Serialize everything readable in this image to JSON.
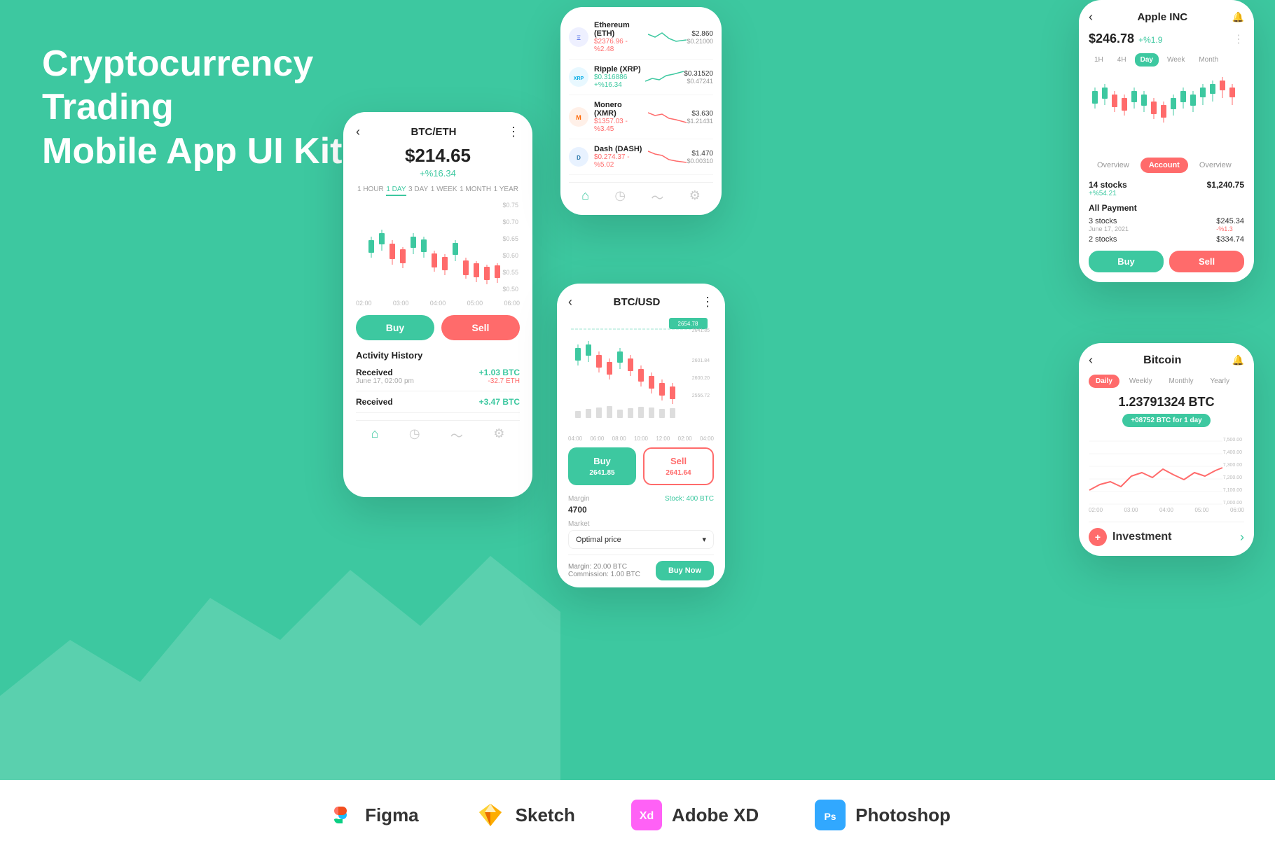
{
  "hero": {
    "title_line1": "Cryptocurrency Trading",
    "title_line2": "Mobile App UI Kit"
  },
  "tools": [
    {
      "name": "Figma",
      "color": "#F24E1E"
    },
    {
      "name": "Sketch",
      "color": "#F7B500"
    },
    {
      "name": "Adobe XD",
      "color": "#FF61F6"
    },
    {
      "name": "Photoshop",
      "color": "#31A8FF"
    }
  ],
  "card_btceth": {
    "title": "BTC/ETH",
    "price": "$214.65",
    "change": "+%16.34",
    "time_tabs": [
      "1 HOUR",
      "1 DAY",
      "3 DAY",
      "1 WEEK",
      "1 MONTH",
      "1 YEAR"
    ],
    "active_tab": "1 DAY",
    "price_labels": [
      "$0.75",
      "$0.70",
      "$0.65",
      "$0.60",
      "$0.55",
      "$0.50"
    ],
    "time_labels": [
      "02:00",
      "03:00",
      "04:00",
      "05:00",
      "06:00"
    ],
    "buy_label": "Buy",
    "sell_label": "Sell",
    "activity_title": "Activity History",
    "activities": [
      {
        "label": "Received",
        "date": "June 17, 02:00 pm",
        "btc": "+1.03 BTC",
        "eth": "-32.7 ETH"
      },
      {
        "label": "Received",
        "date": "",
        "btc": "+3.47 BTC",
        "eth": ""
      }
    ]
  },
  "card_list": {
    "coins": [
      {
        "name": "Ethereum (ETH)",
        "abbr": "ETH",
        "color": "#627EEA",
        "price": "$2376.96",
        "change": "-%2.48",
        "high": "$2.860",
        "low": "$0.21000",
        "trend": "down"
      },
      {
        "name": "Ripple (XRP)",
        "abbr": "XRP",
        "color": "#00AAE4",
        "price": "$0.316886",
        "change": "+%16.34",
        "high": "$0.31520",
        "low": "$0.47241",
        "trend": "up"
      },
      {
        "name": "Monero (XMR)",
        "abbr": "XMR",
        "color": "#FF6600",
        "price": "$1357.03",
        "change": "-%3.45",
        "high": "$3.630",
        "low": "$1.21431",
        "trend": "down"
      },
      {
        "name": "Dash (DASH)",
        "abbr": "D",
        "color": "#2574A9",
        "price": "$0.274.37",
        "change": "-%5.02",
        "high": "$1.470",
        "low": "$0.00310",
        "trend": "down"
      }
    ]
  },
  "card_btcusd": {
    "title": "BTC/USD",
    "price_label": "2654.78",
    "price_labels_right": [
      "2654.78",
      "2641.85",
      "2601.84",
      "2600.20",
      "2556.72"
    ],
    "time_labels": [
      "04:00",
      "06:00",
      "08:00",
      "10:00",
      "12:00",
      "02:00",
      "04:00"
    ],
    "buy_label": "Buy\n2641.85",
    "sell_label": "Sell\n2641.64",
    "margin_label": "Margin",
    "stock_label": "Stock: 400 BTC",
    "margin_value": "4700",
    "market_label": "Market",
    "market_value": "Optimal price",
    "margin_btc": "Margin: 20.00 BTC",
    "commission": "Commission: 1.00 BTC",
    "buy_now": "Buy Now"
  },
  "card_apple": {
    "back": "‹",
    "title": "Apple INC",
    "bell": "🔔",
    "price": "$246.78",
    "change": "+%1.9",
    "more": "⋮",
    "tf_tabs": [
      "1H",
      "4H",
      "Day",
      "Week",
      "Month"
    ],
    "active_tf": "Day",
    "acct_tabs": [
      "Overview",
      "Account",
      "Overview"
    ],
    "active_acct": "Account",
    "stocks_count": "14 stocks",
    "stocks_change": "+%54.21",
    "stocks_value": "$1,240.75",
    "payment_title": "All Payment",
    "payments": [
      {
        "stocks": "3 stocks",
        "date": "June 17, 2021",
        "amount": "$245.34",
        "change": "-%1.3"
      },
      {
        "stocks": "2 stocks",
        "date": "",
        "amount": "$334.74",
        "change": ""
      }
    ],
    "buy_label": "Buy",
    "sell_label": "Sell"
  },
  "card_bitcoin": {
    "back": "‹",
    "title": "Bitcoin",
    "bell": "🔔",
    "period_tabs": [
      "Daily",
      "Weekly",
      "Monthly",
      "Yearly"
    ],
    "active_period": "Daily",
    "amount": "1.23791324 BTC",
    "badge": "+08752 BTC for 1 day",
    "price_labels": [
      "7,500.00",
      "7,400.00",
      "7,300.00",
      "7,200.00",
      "7,100.00",
      "7,000.00"
    ],
    "time_labels": [
      "02:00",
      "03:00",
      "04:00",
      "05:00",
      "06:00"
    ],
    "investment_label": "Investment"
  }
}
